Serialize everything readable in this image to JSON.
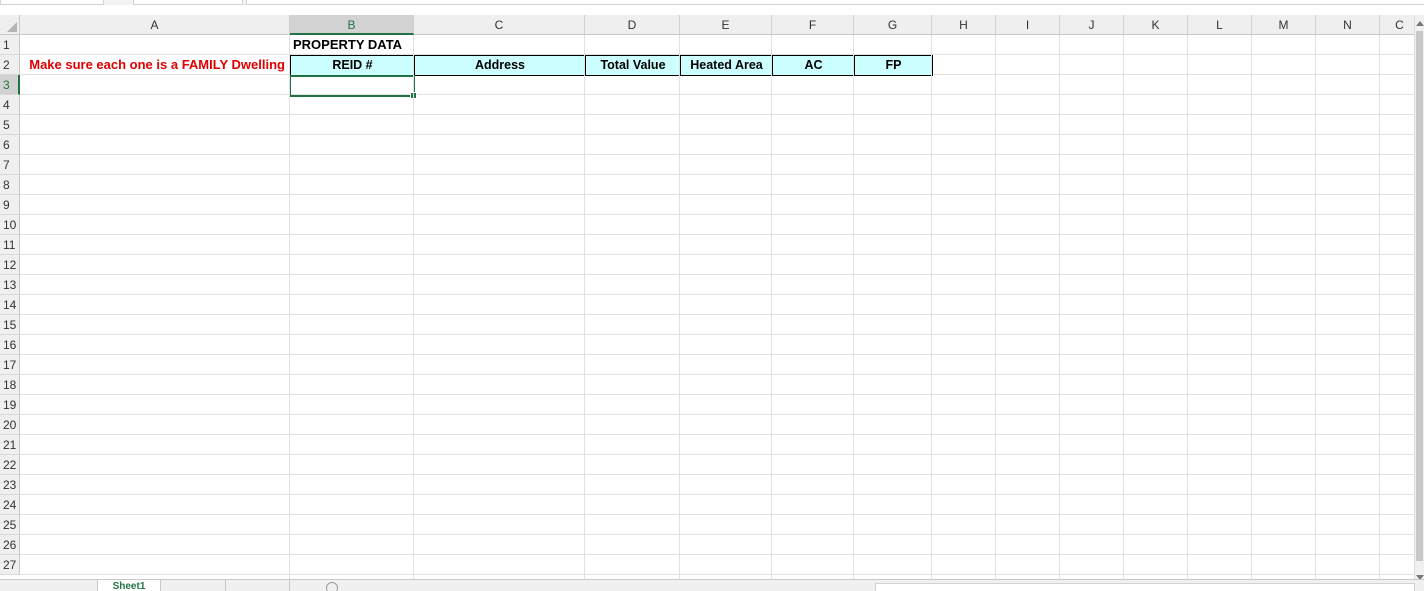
{
  "spreadsheet": {
    "columns": [
      "A",
      "B",
      "C",
      "D",
      "E",
      "F",
      "G",
      "H",
      "I",
      "J",
      "K",
      "L",
      "M",
      "N",
      "C"
    ],
    "active_column": "B",
    "rows": [
      "1",
      "2",
      "3",
      "4",
      "5",
      "6",
      "7",
      "8",
      "9",
      "10",
      "11",
      "12",
      "13",
      "14",
      "15",
      "16",
      "17",
      "18",
      "19",
      "20",
      "21",
      "22",
      "23",
      "24",
      "25",
      "26",
      "27"
    ],
    "active_row": "3",
    "cells": {
      "B1": "PROPERTY DATA",
      "A2": "Make sure each one is a FAMILY Dwelling",
      "B2": "REID #",
      "C2": "Address",
      "D2": "Total Value",
      "E2": "Heated Area",
      "F2": "AC",
      "G2": "FP"
    },
    "selected_cell": "B3"
  },
  "colors": {
    "header_fill": "#ccffff",
    "note_text": "#e00000",
    "selection": "#217346"
  },
  "sheet_tabs": {
    "active_label": "Sheet1",
    "other_labels": [
      "",
      ""
    ]
  }
}
